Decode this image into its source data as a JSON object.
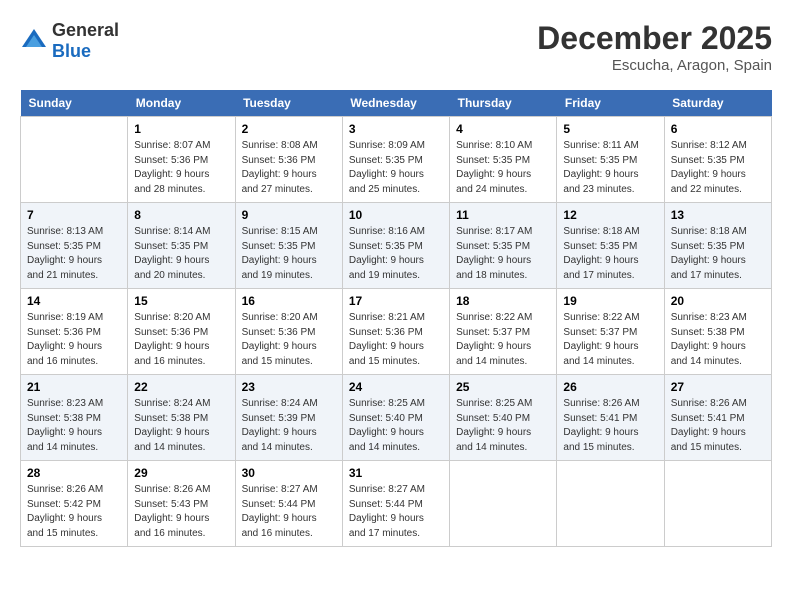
{
  "header": {
    "logo_general": "General",
    "logo_blue": "Blue",
    "month_year": "December 2025",
    "location": "Escucha, Aragon, Spain"
  },
  "days_of_week": [
    "Sunday",
    "Monday",
    "Tuesday",
    "Wednesday",
    "Thursday",
    "Friday",
    "Saturday"
  ],
  "weeks": [
    {
      "shade": "white",
      "days": [
        {
          "number": "",
          "sunrise": "",
          "sunset": "",
          "daylight": ""
        },
        {
          "number": "1",
          "sunrise": "Sunrise: 8:07 AM",
          "sunset": "Sunset: 5:36 PM",
          "daylight": "Daylight: 9 hours and 28 minutes."
        },
        {
          "number": "2",
          "sunrise": "Sunrise: 8:08 AM",
          "sunset": "Sunset: 5:36 PM",
          "daylight": "Daylight: 9 hours and 27 minutes."
        },
        {
          "number": "3",
          "sunrise": "Sunrise: 8:09 AM",
          "sunset": "Sunset: 5:35 PM",
          "daylight": "Daylight: 9 hours and 25 minutes."
        },
        {
          "number": "4",
          "sunrise": "Sunrise: 8:10 AM",
          "sunset": "Sunset: 5:35 PM",
          "daylight": "Daylight: 9 hours and 24 minutes."
        },
        {
          "number": "5",
          "sunrise": "Sunrise: 8:11 AM",
          "sunset": "Sunset: 5:35 PM",
          "daylight": "Daylight: 9 hours and 23 minutes."
        },
        {
          "number": "6",
          "sunrise": "Sunrise: 8:12 AM",
          "sunset": "Sunset: 5:35 PM",
          "daylight": "Daylight: 9 hours and 22 minutes."
        }
      ]
    },
    {
      "shade": "shaded",
      "days": [
        {
          "number": "7",
          "sunrise": "Sunrise: 8:13 AM",
          "sunset": "Sunset: 5:35 PM",
          "daylight": "Daylight: 9 hours and 21 minutes."
        },
        {
          "number": "8",
          "sunrise": "Sunrise: 8:14 AM",
          "sunset": "Sunset: 5:35 PM",
          "daylight": "Daylight: 9 hours and 20 minutes."
        },
        {
          "number": "9",
          "sunrise": "Sunrise: 8:15 AM",
          "sunset": "Sunset: 5:35 PM",
          "daylight": "Daylight: 9 hours and 19 minutes."
        },
        {
          "number": "10",
          "sunrise": "Sunrise: 8:16 AM",
          "sunset": "Sunset: 5:35 PM",
          "daylight": "Daylight: 9 hours and 19 minutes."
        },
        {
          "number": "11",
          "sunrise": "Sunrise: 8:17 AM",
          "sunset": "Sunset: 5:35 PM",
          "daylight": "Daylight: 9 hours and 18 minutes."
        },
        {
          "number": "12",
          "sunrise": "Sunrise: 8:18 AM",
          "sunset": "Sunset: 5:35 PM",
          "daylight": "Daylight: 9 hours and 17 minutes."
        },
        {
          "number": "13",
          "sunrise": "Sunrise: 8:18 AM",
          "sunset": "Sunset: 5:35 PM",
          "daylight": "Daylight: 9 hours and 17 minutes."
        }
      ]
    },
    {
      "shade": "white",
      "days": [
        {
          "number": "14",
          "sunrise": "Sunrise: 8:19 AM",
          "sunset": "Sunset: 5:36 PM",
          "daylight": "Daylight: 9 hours and 16 minutes."
        },
        {
          "number": "15",
          "sunrise": "Sunrise: 8:20 AM",
          "sunset": "Sunset: 5:36 PM",
          "daylight": "Daylight: 9 hours and 16 minutes."
        },
        {
          "number": "16",
          "sunrise": "Sunrise: 8:20 AM",
          "sunset": "Sunset: 5:36 PM",
          "daylight": "Daylight: 9 hours and 15 minutes."
        },
        {
          "number": "17",
          "sunrise": "Sunrise: 8:21 AM",
          "sunset": "Sunset: 5:36 PM",
          "daylight": "Daylight: 9 hours and 15 minutes."
        },
        {
          "number": "18",
          "sunrise": "Sunrise: 8:22 AM",
          "sunset": "Sunset: 5:37 PM",
          "daylight": "Daylight: 9 hours and 14 minutes."
        },
        {
          "number": "19",
          "sunrise": "Sunrise: 8:22 AM",
          "sunset": "Sunset: 5:37 PM",
          "daylight": "Daylight: 9 hours and 14 minutes."
        },
        {
          "number": "20",
          "sunrise": "Sunrise: 8:23 AM",
          "sunset": "Sunset: 5:38 PM",
          "daylight": "Daylight: 9 hours and 14 minutes."
        }
      ]
    },
    {
      "shade": "shaded",
      "days": [
        {
          "number": "21",
          "sunrise": "Sunrise: 8:23 AM",
          "sunset": "Sunset: 5:38 PM",
          "daylight": "Daylight: 9 hours and 14 minutes."
        },
        {
          "number": "22",
          "sunrise": "Sunrise: 8:24 AM",
          "sunset": "Sunset: 5:38 PM",
          "daylight": "Daylight: 9 hours and 14 minutes."
        },
        {
          "number": "23",
          "sunrise": "Sunrise: 8:24 AM",
          "sunset": "Sunset: 5:39 PM",
          "daylight": "Daylight: 9 hours and 14 minutes."
        },
        {
          "number": "24",
          "sunrise": "Sunrise: 8:25 AM",
          "sunset": "Sunset: 5:40 PM",
          "daylight": "Daylight: 9 hours and 14 minutes."
        },
        {
          "number": "25",
          "sunrise": "Sunrise: 8:25 AM",
          "sunset": "Sunset: 5:40 PM",
          "daylight": "Daylight: 9 hours and 14 minutes."
        },
        {
          "number": "26",
          "sunrise": "Sunrise: 8:26 AM",
          "sunset": "Sunset: 5:41 PM",
          "daylight": "Daylight: 9 hours and 15 minutes."
        },
        {
          "number": "27",
          "sunrise": "Sunrise: 8:26 AM",
          "sunset": "Sunset: 5:41 PM",
          "daylight": "Daylight: 9 hours and 15 minutes."
        }
      ]
    },
    {
      "shade": "white",
      "days": [
        {
          "number": "28",
          "sunrise": "Sunrise: 8:26 AM",
          "sunset": "Sunset: 5:42 PM",
          "daylight": "Daylight: 9 hours and 15 minutes."
        },
        {
          "number": "29",
          "sunrise": "Sunrise: 8:26 AM",
          "sunset": "Sunset: 5:43 PM",
          "daylight": "Daylight: 9 hours and 16 minutes."
        },
        {
          "number": "30",
          "sunrise": "Sunrise: 8:27 AM",
          "sunset": "Sunset: 5:44 PM",
          "daylight": "Daylight: 9 hours and 16 minutes."
        },
        {
          "number": "31",
          "sunrise": "Sunrise: 8:27 AM",
          "sunset": "Sunset: 5:44 PM",
          "daylight": "Daylight: 9 hours and 17 minutes."
        },
        {
          "number": "",
          "sunrise": "",
          "sunset": "",
          "daylight": ""
        },
        {
          "number": "",
          "sunrise": "",
          "sunset": "",
          "daylight": ""
        },
        {
          "number": "",
          "sunrise": "",
          "sunset": "",
          "daylight": ""
        }
      ]
    }
  ]
}
